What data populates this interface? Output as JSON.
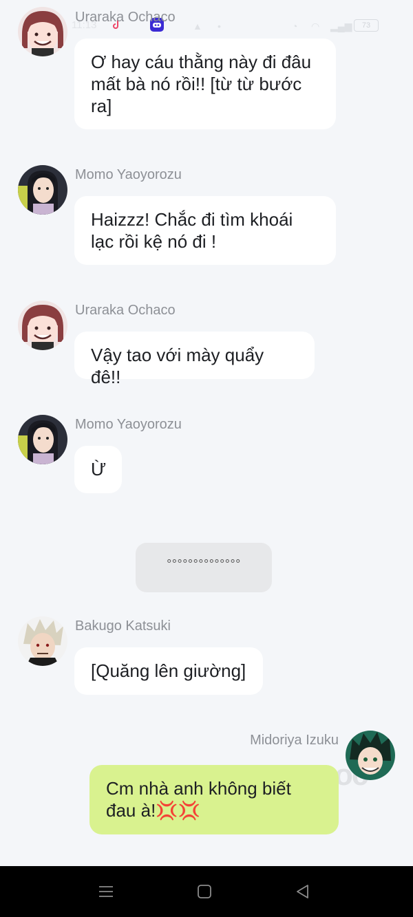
{
  "status_bar": {
    "time": "11:13",
    "battery": "73"
  },
  "messages": [
    {
      "sender": "Uraraka Ochaco",
      "text": "Ơ hay cáu thằng này đi đâu mất bà nó rồi!! [từ từ bước ra]",
      "side": "left",
      "avatar": "uraraka"
    },
    {
      "sender": "Momo Yaoyorozu",
      "text": "Haizzz! Chắc đi tìm khoái lạc rồi kệ nó đi !",
      "side": "left",
      "avatar": "momo"
    },
    {
      "sender": "Uraraka Ochaco",
      "text": "Vậy tao với mày quẩy đê!!",
      "side": "left",
      "avatar": "uraraka"
    },
    {
      "sender": "Momo Yaoyorozu",
      "text": "Ừ",
      "side": "left",
      "avatar": "momo"
    },
    {
      "sender": "Bakugo Katsuki",
      "text": "[Quăng lên giường]",
      "side": "left",
      "avatar": "bakugo"
    },
    {
      "sender": "Midoriya Izuku",
      "text": "Cm nhà anh không biết đau à!💢💢",
      "side": "right",
      "avatar": "midoriya"
    }
  ],
  "narration": "°°°°°°°°°°°°°°",
  "watermark": "oc",
  "colors": {
    "background": "#f4f6f9",
    "bubble_other": "#ffffff",
    "bubble_me": "#d9f28f",
    "sender_name": "#8d9096"
  }
}
